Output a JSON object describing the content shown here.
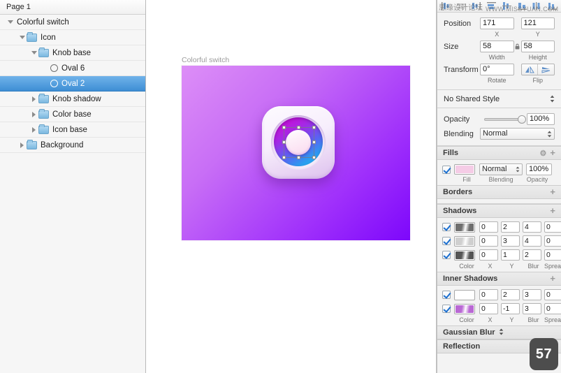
{
  "sidebar": {
    "page_label": "Page 1",
    "layers": [
      {
        "label": "Colorful switch",
        "depth": 0,
        "type": "group",
        "arrow": "open",
        "selected": false,
        "icon": "disclosure-triangle-open-icon"
      },
      {
        "label": "Icon",
        "depth": 1,
        "type": "folder",
        "arrow": "open",
        "selected": false,
        "icon": "folder-icon"
      },
      {
        "label": "Knob base",
        "depth": 2,
        "type": "folder",
        "arrow": "open",
        "selected": false,
        "icon": "folder-icon"
      },
      {
        "label": "Oval 6",
        "depth": 3,
        "type": "oval",
        "arrow": "none",
        "selected": false,
        "icon": "oval-shape-icon"
      },
      {
        "label": "Oval 2",
        "depth": 3,
        "type": "oval",
        "arrow": "none",
        "selected": true,
        "icon": "oval-shape-icon"
      },
      {
        "label": "Knob shadow",
        "depth": 2,
        "type": "folder",
        "arrow": "closed",
        "selected": false,
        "icon": "folder-icon"
      },
      {
        "label": "Color base",
        "depth": 2,
        "type": "folder",
        "arrow": "closed",
        "selected": false,
        "icon": "folder-icon"
      },
      {
        "label": "Icon base",
        "depth": 2,
        "type": "folder",
        "arrow": "closed",
        "selected": false,
        "icon": "folder-icon"
      },
      {
        "label": "Background",
        "depth": 1,
        "type": "folder",
        "arrow": "closed",
        "selected": false,
        "icon": "folder-icon"
      }
    ],
    "selection_color": "#3e8ed4"
  },
  "canvas": {
    "artboard_label": "Colorful switch",
    "artboard_gradient_from": "#dd8ef7",
    "artboard_gradient_to": "#7d07fb",
    "ring_gradient_from": "#b813c8",
    "ring_gradient_to": "#18c8f0",
    "knob_color": "#f9d9ee"
  },
  "inspector": {
    "align_buttons": [
      "align-left-icon",
      "align-horizontal-center-icon",
      "align-right-icon",
      "align-top-icon",
      "align-vertical-center-icon",
      "align-bottom-icon",
      "distribute-horizontally-icon",
      "distribute-vertically-icon"
    ],
    "watermark_cn": "思缘设计论坛",
    "watermark_en": "WWW.MISSYUAN.COM",
    "geometry": {
      "position_label": "Position",
      "position_x": "171",
      "position_y": "121",
      "x_caption": "X",
      "y_caption": "Y",
      "size_label": "Size",
      "width": "58",
      "height": "58",
      "width_caption": "Width",
      "height_caption": "Height",
      "lock_icon": "lock-icon",
      "transform_label": "Transform",
      "rotate": "0°",
      "rotate_caption": "Rotate",
      "flip_caption": "Flip",
      "flip_horizontal_icon": "flip-horizontal-icon",
      "flip_vertical_icon": "flip-vertical-icon"
    },
    "shared_style": {
      "label": "No Shared Style",
      "stepper_icon": "stepper-up-down-icon"
    },
    "appearance": {
      "opacity_label": "Opacity",
      "opacity_value": "100%",
      "blending_label": "Blending",
      "blending_value": "Normal"
    },
    "fills": {
      "title": "Fills",
      "gear_icon": "gear-icon",
      "add_icon": "plus-icon",
      "rows": [
        {
          "enabled": true,
          "color": "#f5cce6",
          "blending": "Normal",
          "opacity": "100%"
        }
      ],
      "captions": {
        "fill": "Fill",
        "blending": "Blending",
        "opacity": "Opacity"
      }
    },
    "borders": {
      "title": "Borders",
      "add_icon": "plus-icon"
    },
    "shadows": {
      "title": "Shadows",
      "add_icon": "plus-icon",
      "rows": [
        {
          "enabled": true,
          "color": "#6e6e6e",
          "x": "0",
          "y": "2",
          "blur": "4",
          "spread": "0"
        },
        {
          "enabled": true,
          "color": "#cfcfcf",
          "x": "0",
          "y": "3",
          "blur": "4",
          "spread": "0"
        },
        {
          "enabled": true,
          "color": "#555555",
          "x": "0",
          "y": "1",
          "blur": "2",
          "spread": "0"
        }
      ],
      "captions": {
        "color": "Color",
        "x": "X",
        "y": "Y",
        "blur": "Blur",
        "spread": "Spread"
      }
    },
    "inner_shadows": {
      "title": "Inner Shadows",
      "add_icon": "plus-icon",
      "rows": [
        {
          "enabled": true,
          "color": "#ffffff",
          "x": "0",
          "y": "2",
          "blur": "3",
          "spread": "0"
        },
        {
          "enabled": true,
          "color": "#b968d4",
          "x": "0",
          "y": "-1",
          "blur": "3",
          "spread": "0"
        }
      ],
      "captions": {
        "color": "Color",
        "x": "X",
        "y": "Y",
        "blur": "Blur",
        "spread": "Spread"
      }
    },
    "gaussian_blur": {
      "title": "Gaussian Blur",
      "stepper_icon": "stepper-up-down-icon"
    },
    "reflection": {
      "title": "Reflection"
    },
    "badge": {
      "value": "57",
      "color": "#4d4d4d"
    }
  }
}
